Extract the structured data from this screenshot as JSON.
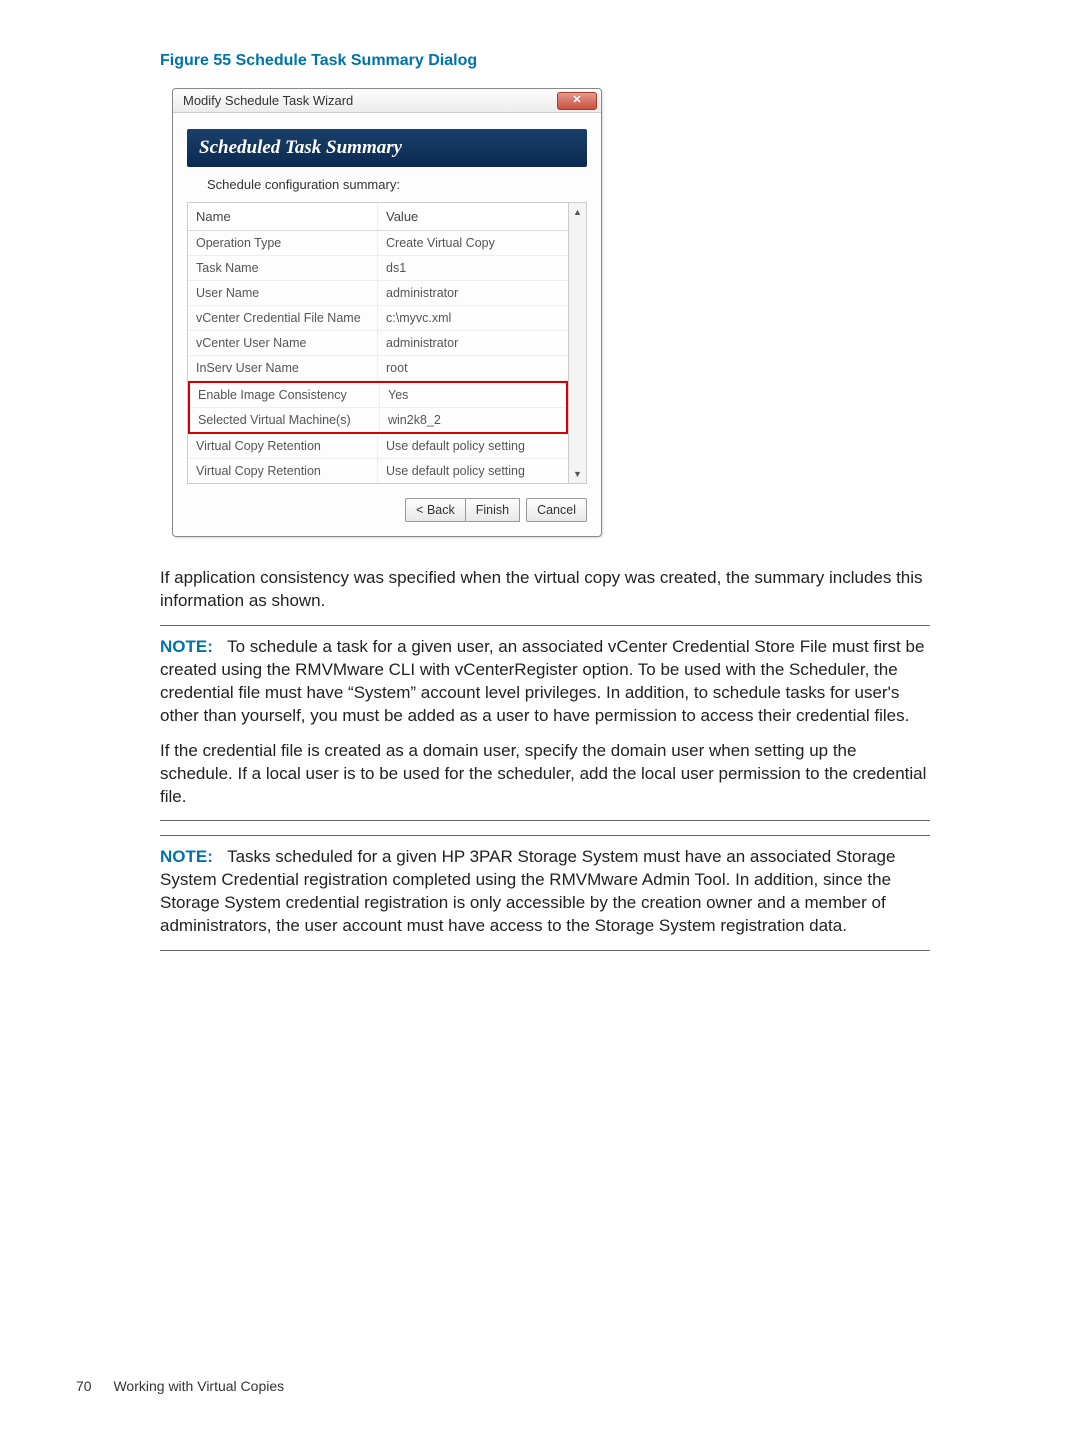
{
  "figure_caption": "Figure 55 Schedule Task Summary Dialog",
  "dialog": {
    "title": "Modify Schedule Task Wizard",
    "close_glyph": "✕",
    "banner_title": "Scheduled Task Summary",
    "subhead": "Schedule configuration summary:",
    "columns": {
      "name": "Name",
      "value": "Value"
    },
    "rows": [
      {
        "name": "Operation Type",
        "value": "Create Virtual Copy"
      },
      {
        "name": "Task Name",
        "value": "ds1"
      },
      {
        "name": "User Name",
        "value": "administrator"
      },
      {
        "name": "vCenter Credential File Name",
        "value": "c:\\myvc.xml"
      },
      {
        "name": "vCenter User Name",
        "value": "administrator"
      },
      {
        "name": "InServ User Name",
        "value": "root"
      }
    ],
    "highlight_rows": [
      {
        "name": "Enable Image Consistency",
        "value": "Yes"
      },
      {
        "name": "Selected Virtual Machine(s)",
        "value": "win2k8_2"
      }
    ],
    "rows_after": [
      {
        "name": "Virtual Copy Retention",
        "value": "Use default policy setting"
      },
      {
        "name": "Virtual Copy Retention",
        "value": "Use default policy setting"
      }
    ],
    "buttons": {
      "back": "< Back",
      "finish": "Finish",
      "cancel": "Cancel"
    },
    "scroll": {
      "up": "▲",
      "down": "▼"
    }
  },
  "para_intro": "If application consistency was specified when the virtual copy was created, the summary includes this information as shown.",
  "note1": {
    "label": "NOTE:",
    "p1": "To schedule a task for a given user, an associated vCenter Credential Store File must first be created using the RMVMware CLI with vCenterRegister option. To be used with the Scheduler, the credential file must have “System” account level privileges. In addition, to schedule tasks for user's other than yourself, you must be added as a user to have permission to access their credential files.",
    "p2": "If the credential file is created as a domain user, specify the domain user when setting up the schedule. If a local user is to be used for the scheduler, add the local user permission to the credential file."
  },
  "note2": {
    "label": "NOTE:",
    "p1": "Tasks scheduled for a given HP 3PAR Storage System must have an associated Storage System Credential registration completed using the RMVMware Admin Tool. In addition, since the Storage System credential registration is only accessible by the creation owner and a member of administrators, the user account must have access to the Storage System registration data."
  },
  "footer": {
    "page": "70",
    "section": "Working with Virtual Copies"
  }
}
